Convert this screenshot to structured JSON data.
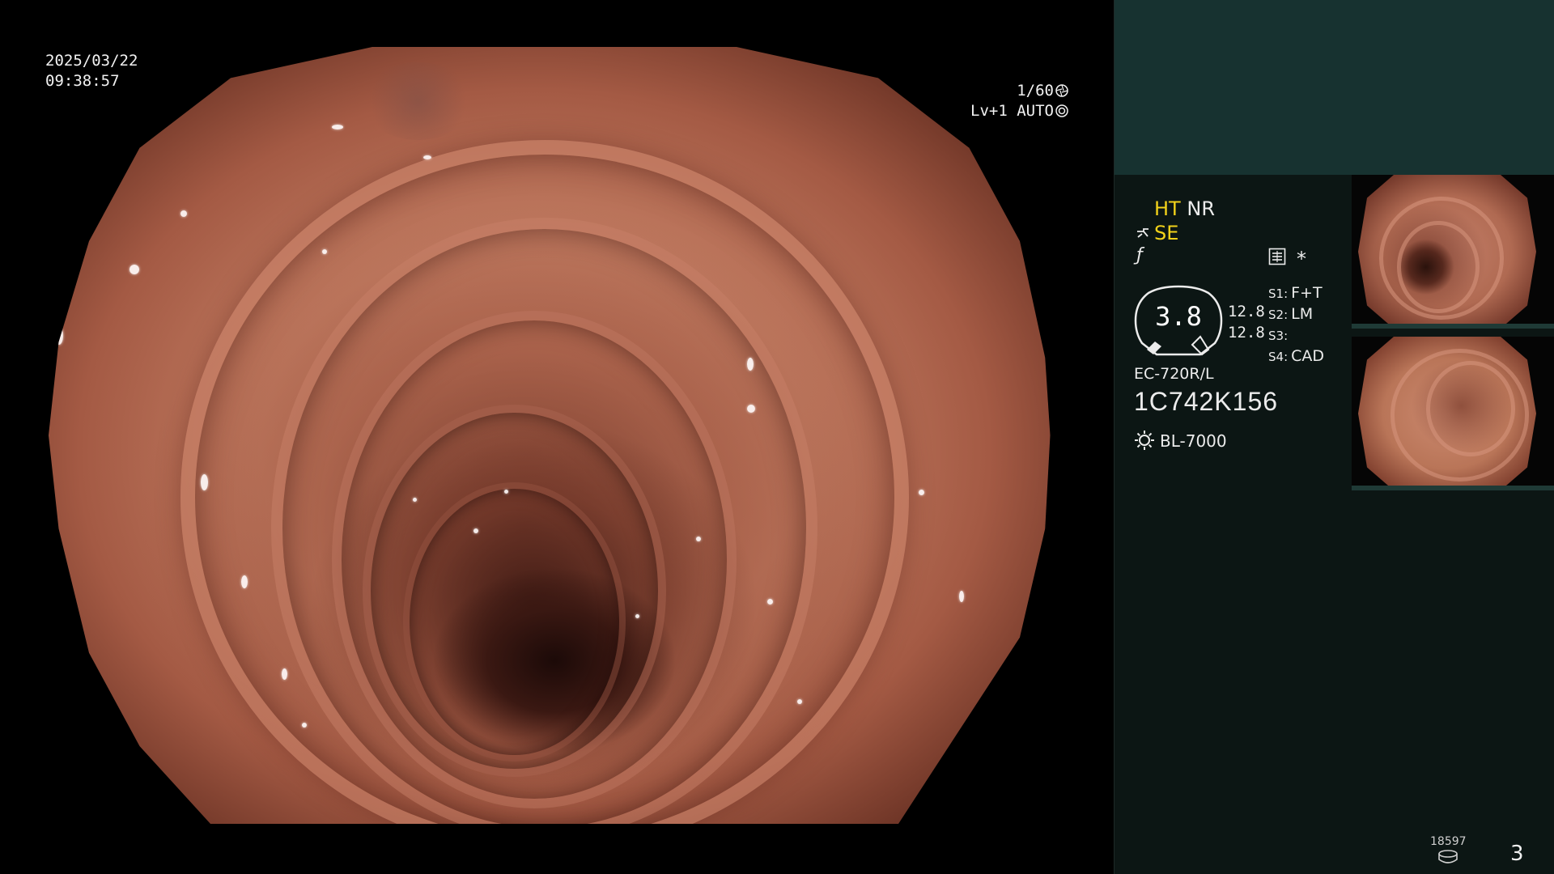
{
  "overlay": {
    "date": "2025/03/22",
    "time": "09:38:57",
    "shutter": "1/60",
    "level": "Lv+1",
    "exposure_mode": "AUTO"
  },
  "panel": {
    "mode_ht": "HT",
    "mode_nr": "NR",
    "se": "SE",
    "star": "*",
    "zoom": "3.8",
    "iris_1": "12.8",
    "iris_2": "12.8",
    "switches": [
      {
        "key": "S1:",
        "value": "F+T"
      },
      {
        "key": "S2:",
        "value": "LM"
      },
      {
        "key": "S3:",
        "value": ""
      },
      {
        "key": "S4:",
        "value": "CAD"
      }
    ],
    "scope_model": "EC-720R/L",
    "scope_serial": "1C742K156",
    "light_source": "BL-7000",
    "counter": "18597",
    "page_number": "3"
  },
  "colors": {
    "panel_bg": "#0c1614",
    "panel_top": "#173230",
    "highlight": "#f2d21a",
    "text": "#ececec"
  },
  "icons": {
    "shutter": "aperture-icon",
    "exposure": "exposure-icon",
    "scope": "endoscope-tip-icon",
    "function": "function-icon",
    "menu": "menu-list-icon",
    "light": "sun-icon",
    "storage": "disk-icon"
  }
}
